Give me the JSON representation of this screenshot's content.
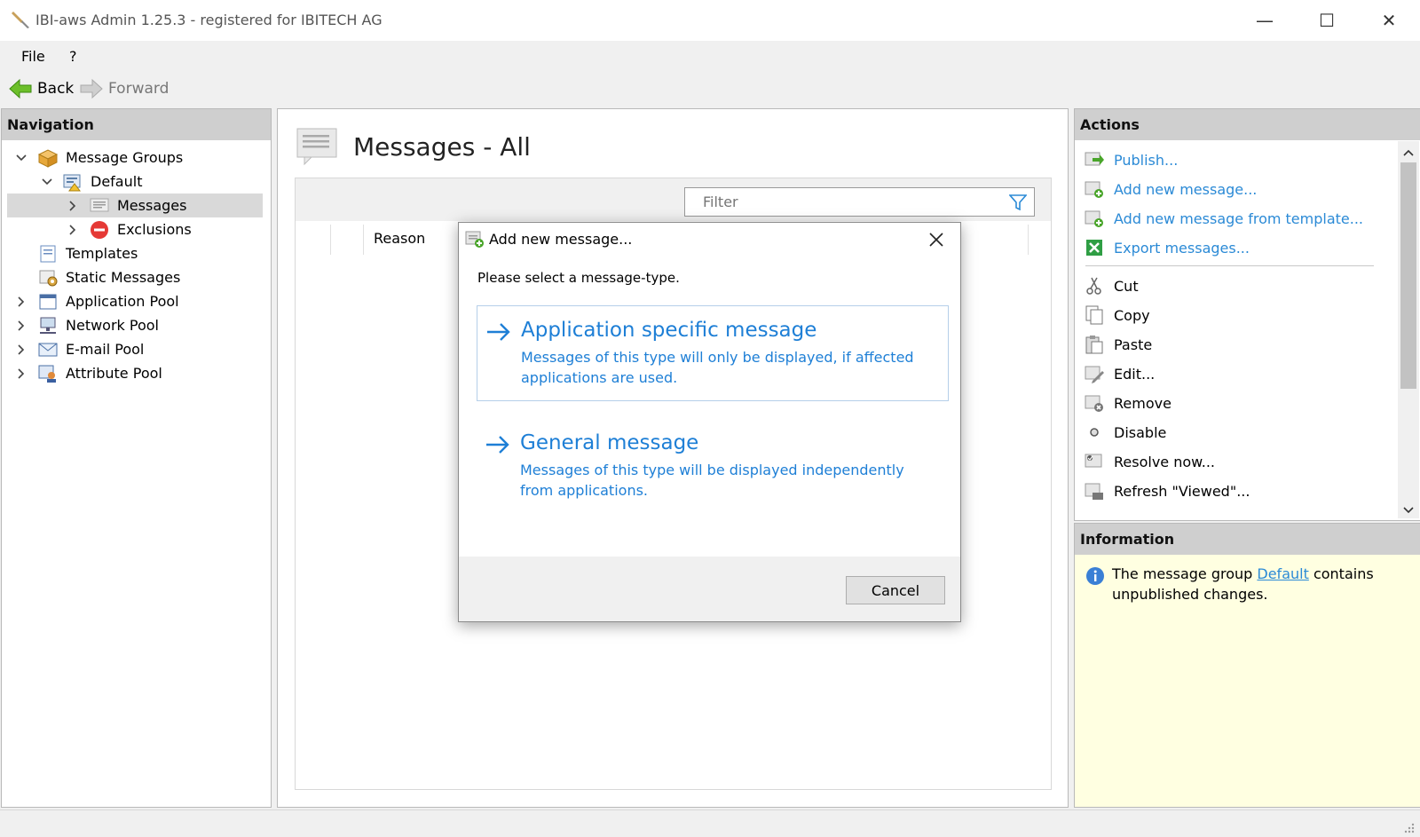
{
  "window": {
    "title": "IBI-aws Admin 1.25.3 - registered for IBITECH AG",
    "minimize": "—",
    "maximize": "☐",
    "close": "✕"
  },
  "menu": {
    "file": "File",
    "help": "?"
  },
  "toolbar": {
    "back": "Back",
    "forward": "Forward"
  },
  "navigation": {
    "header": "Navigation",
    "items": [
      {
        "label": "Message Groups",
        "icon": "message-groups-icon"
      },
      {
        "label": "Default",
        "icon": "default-group-icon"
      },
      {
        "label": "Messages",
        "icon": "messages-icon"
      },
      {
        "label": "Exclusions",
        "icon": "exclusions-icon"
      },
      {
        "label": "Templates",
        "icon": "templates-icon"
      },
      {
        "label": "Static Messages",
        "icon": "static-messages-icon"
      },
      {
        "label": "Application Pool",
        "icon": "application-pool-icon"
      },
      {
        "label": "Network Pool",
        "icon": "network-pool-icon"
      },
      {
        "label": "E-mail Pool",
        "icon": "email-pool-icon"
      },
      {
        "label": "Attribute Pool",
        "icon": "attribute-pool-icon"
      }
    ]
  },
  "main": {
    "title": "Messages - All",
    "filter_placeholder": "Filter",
    "columns": {
      "reason": "Reason"
    }
  },
  "actions": {
    "header": "Actions",
    "items": [
      {
        "label": "Publish..."
      },
      {
        "label": "Add new message..."
      },
      {
        "label": "Add new message from template..."
      },
      {
        "label": "Export messages..."
      },
      {
        "label": "Cut"
      },
      {
        "label": "Copy"
      },
      {
        "label": "Paste"
      },
      {
        "label": "Edit..."
      },
      {
        "label": "Remove"
      },
      {
        "label": "Disable"
      },
      {
        "label": "Resolve now..."
      },
      {
        "label": "Refresh \"Viewed\"..."
      }
    ]
  },
  "information": {
    "header": "Information",
    "text_before": "The message group ",
    "link": "Default",
    "text_after": " contains unpublished changes."
  },
  "dialog": {
    "title": "Add new message...",
    "prompt": "Please select a message-type.",
    "options": [
      {
        "title": "Application specific message",
        "description": "Messages of this type will only be displayed, if affected applications are used."
      },
      {
        "title": "General message",
        "description": "Messages of this type will be displayed independently from applications."
      }
    ],
    "cancel": "Cancel"
  },
  "colors": {
    "link": "#2b8ad6",
    "info_bg": "#ffffe1",
    "header_bg": "#cfcfcf"
  }
}
